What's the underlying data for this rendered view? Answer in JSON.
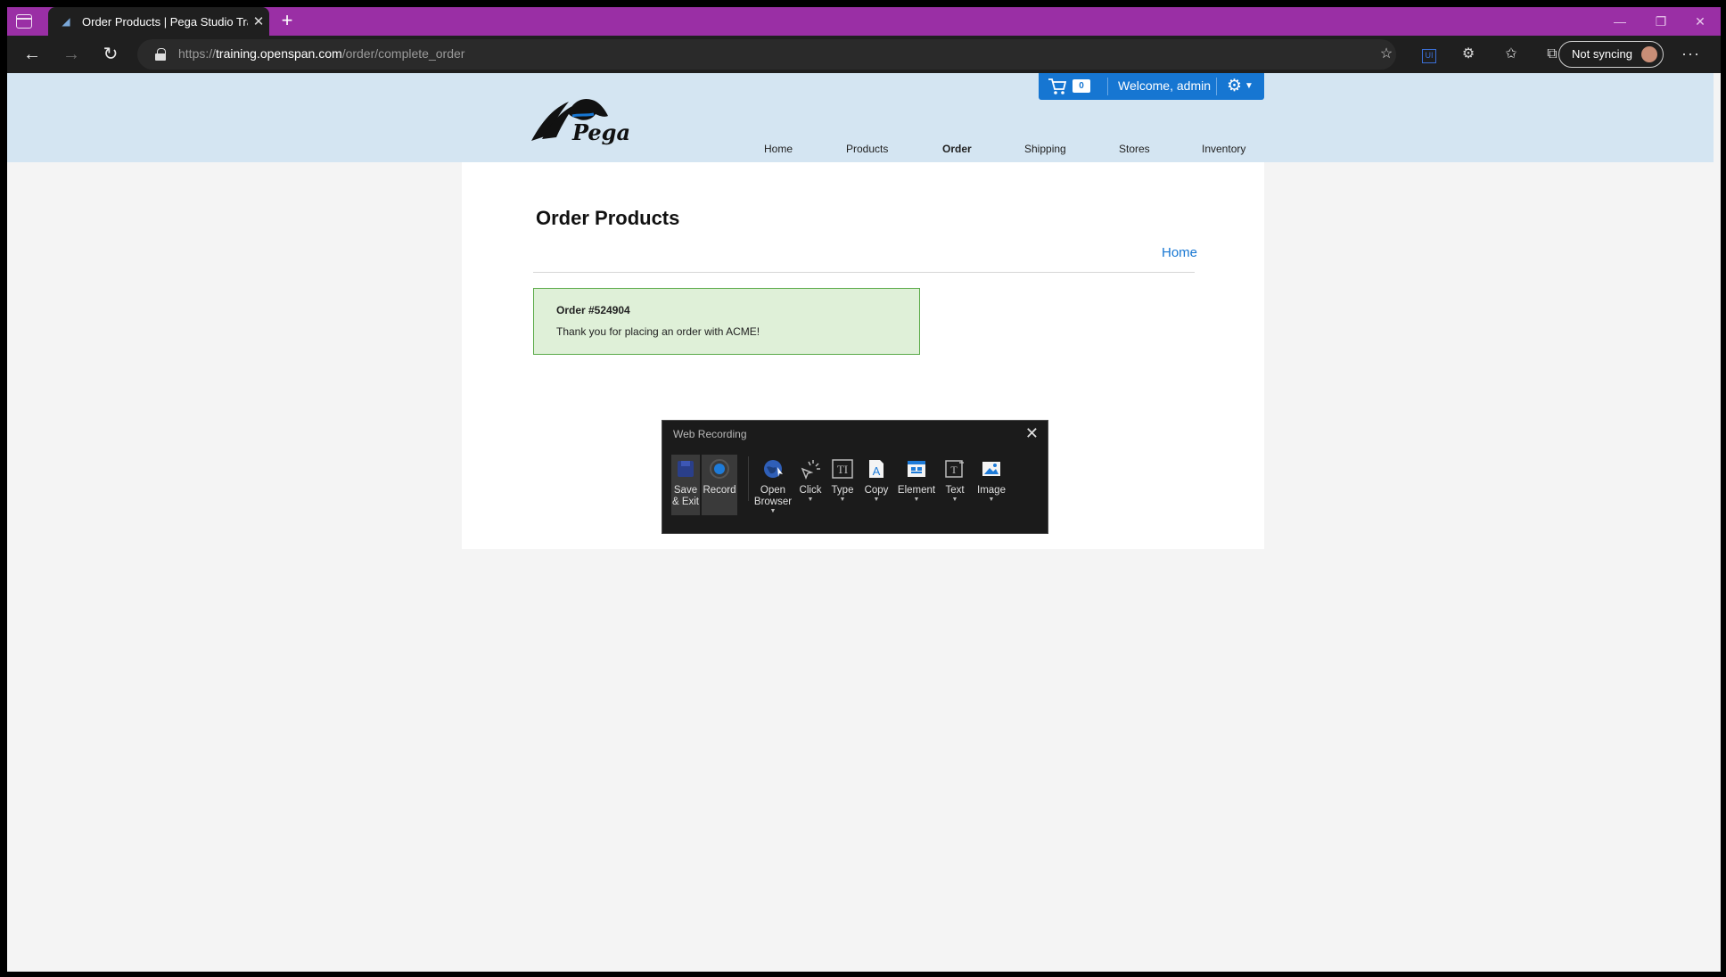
{
  "browser": {
    "tab_title": "Order Products | Pega Studio Tra",
    "new_tab": "+",
    "url_prefix": "https://",
    "url_host": "training.openspan.com",
    "url_path": "/order/complete_order",
    "sync_label": "Not syncing",
    "window_controls": [
      "minimize",
      "restore",
      "close"
    ]
  },
  "site": {
    "logo_text": "Pega",
    "nav": [
      "Home",
      "Products",
      "Order",
      "Shipping",
      "Stores",
      "Inventory"
    ],
    "active_nav": "Order",
    "cart_count": "0",
    "welcome": "Welcome, admin"
  },
  "content": {
    "title": "Order Products",
    "home_link": "Home",
    "order_number": "Order #524904",
    "message": "Thank you for placing an order with ACME!"
  },
  "recorder": {
    "title": "Web Recording",
    "buttons": [
      {
        "label1": "Save",
        "label2": "& Exit",
        "icon": "save-exit-icon"
      },
      {
        "label1": "Record",
        "label2": "",
        "icon": "record-icon"
      },
      {
        "label1": "Open",
        "label2": "Browser",
        "icon": "globe-icon"
      },
      {
        "label1": "Click",
        "label2": "",
        "icon": "click-icon"
      },
      {
        "label1": "Type",
        "label2": "",
        "icon": "type-icon"
      },
      {
        "label1": "Copy",
        "label2": "",
        "icon": "copy-icon"
      },
      {
        "label1": "Element",
        "label2": "",
        "icon": "element-icon"
      },
      {
        "label1": "Text",
        "label2": "",
        "icon": "text-icon"
      },
      {
        "label1": "Image",
        "label2": "",
        "icon": "image-icon"
      }
    ]
  }
}
